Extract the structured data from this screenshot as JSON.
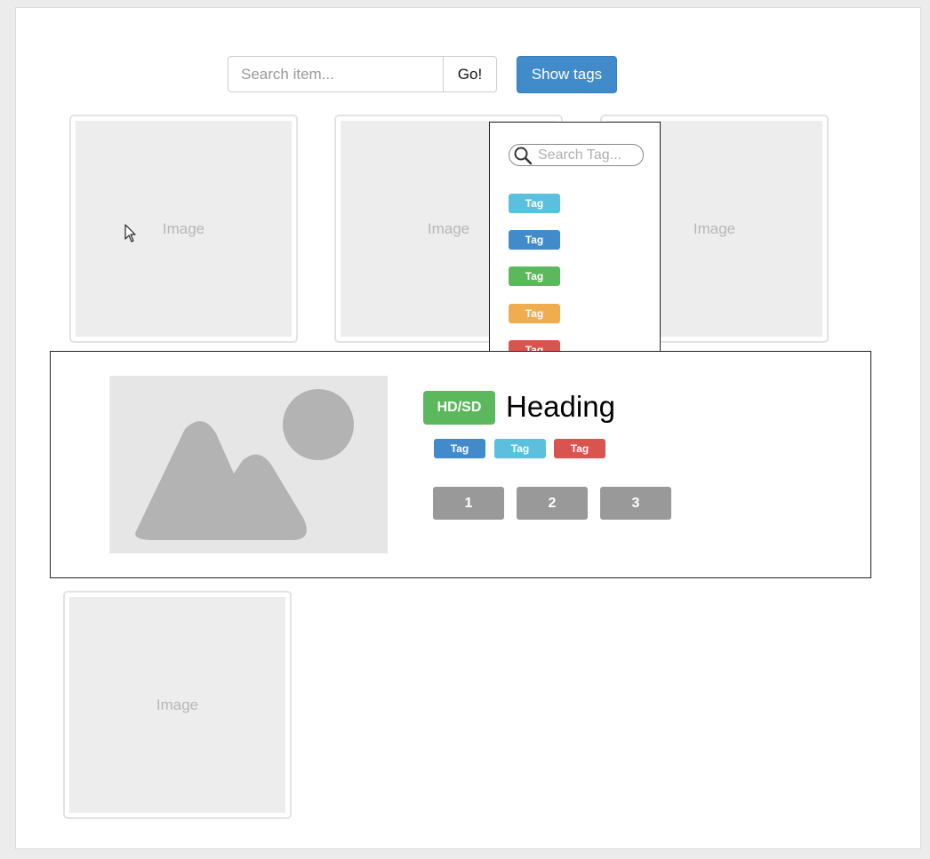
{
  "search": {
    "placeholder": "Search item...",
    "go_label": "Go!"
  },
  "toolbar": {
    "show_tags_label": "Show tags"
  },
  "thumbnails": [
    {
      "label": "Image"
    },
    {
      "label": "Image"
    },
    {
      "label": "Image"
    },
    {
      "label": "Image"
    }
  ],
  "tag_panel": {
    "search_placeholder": "Search Tag...",
    "tags": [
      {
        "label": "Tag",
        "color": "#5bc0de"
      },
      {
        "label": "Tag",
        "color": "#428bca"
      },
      {
        "label": "Tag",
        "color": "#5cb85c"
      },
      {
        "label": "Tag",
        "color": "#f0ad4e"
      },
      {
        "label": "Tag",
        "color": "#d9534f"
      }
    ]
  },
  "detail": {
    "badge": "HD/SD",
    "badge_color": "#5cb85c",
    "heading": "Heading",
    "tags": [
      {
        "label": "Tag",
        "color": "#428bca"
      },
      {
        "label": "Tag",
        "color": "#5bc0de"
      },
      {
        "label": "Tag",
        "color": "#d9534f"
      }
    ],
    "pages": [
      "1",
      "2",
      "3"
    ],
    "image_icon": "image-placeholder-icon"
  }
}
